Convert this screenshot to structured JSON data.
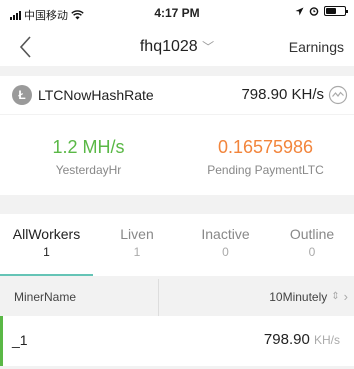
{
  "status_bar": {
    "carrier": "中国移动",
    "time": "4:17 PM"
  },
  "nav": {
    "title": "fhq1028",
    "right_label": "Earnings"
  },
  "hashrate": {
    "label": "LTCNowHashRate",
    "value": "798.90 KH/s"
  },
  "stats": [
    {
      "value": "1.2 MH/s",
      "label": "YesterdayHr"
    },
    {
      "value": "0.16575986",
      "label": "Pending PaymentLTC"
    }
  ],
  "tabs": [
    {
      "label": "AllWorkers",
      "count": "1"
    },
    {
      "label": "Liven",
      "count": "1"
    },
    {
      "label": "Inactive",
      "count": "0"
    },
    {
      "label": "Outline",
      "count": "0"
    }
  ],
  "table": {
    "col_name": "MinerName",
    "col_rate": "10Minutely",
    "rows": [
      {
        "name": "_1",
        "value": "798.90",
        "unit": "KH/s"
      }
    ]
  },
  "colors": {
    "accent_green": "#5ab846",
    "accent_orange": "#f2853c",
    "tab_underline": "#65c4b6"
  }
}
